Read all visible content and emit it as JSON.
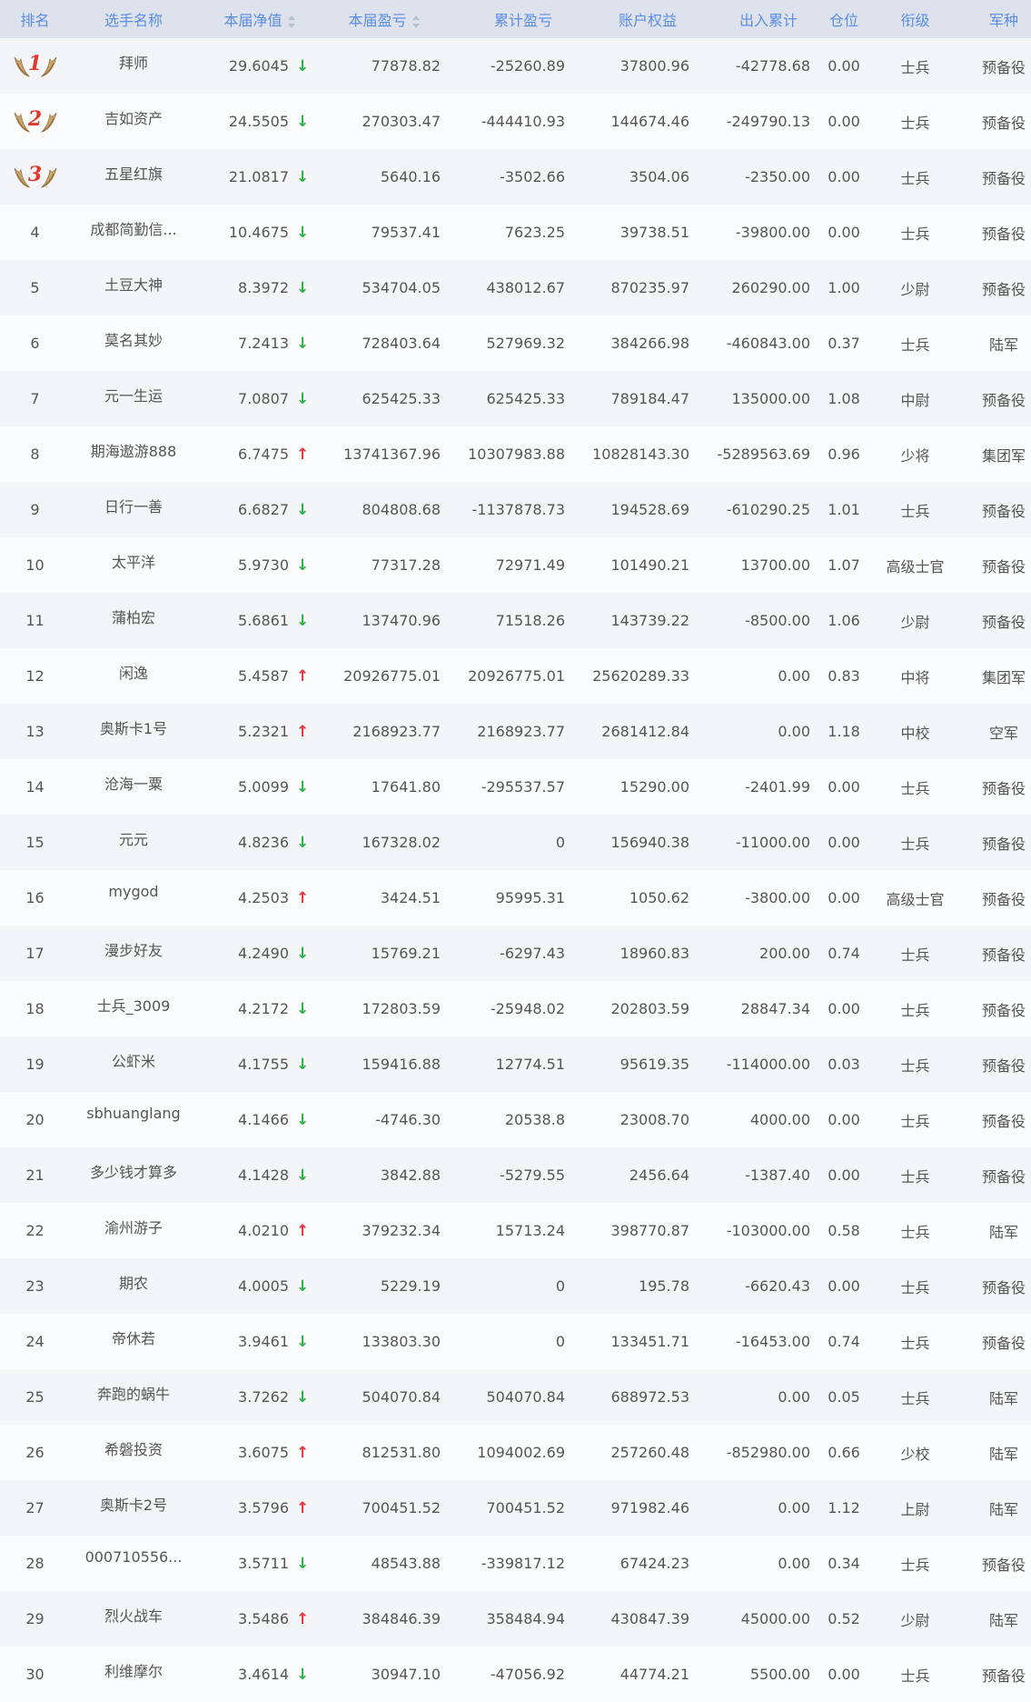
{
  "headers": {
    "rank": "排名",
    "name": "选手名称",
    "nav": "本届净值",
    "pnl": "本届盈亏",
    "cum_pnl": "累计盈亏",
    "equity": "账户权益",
    "io": "出入累计",
    "position": "仓位",
    "level": "衔级",
    "branch": "军种"
  },
  "colors": {
    "header_text": "#5b8de0",
    "up": "#e6363a",
    "down": "#2db245",
    "medal": "#e03a2e"
  },
  "rows": [
    {
      "rank": "1",
      "name": "拜师",
      "nav": "29.6045",
      "trend": "down",
      "pnl": "77878.82",
      "cum": "-25260.89",
      "equity": "37800.96",
      "io": "-42778.68",
      "pos": "0.00",
      "level": "士兵",
      "branch": "预备役"
    },
    {
      "rank": "2",
      "name": "吉如资产",
      "nav": "24.5505",
      "trend": "down",
      "pnl": "270303.47",
      "cum": "-444410.93",
      "equity": "144674.46",
      "io": "-249790.13",
      "pos": "0.00",
      "level": "士兵",
      "branch": "预备役"
    },
    {
      "rank": "3",
      "name": "五星红旗",
      "nav": "21.0817",
      "trend": "down",
      "pnl": "5640.16",
      "cum": "-3502.66",
      "equity": "3504.06",
      "io": "-2350.00",
      "pos": "0.00",
      "level": "士兵",
      "branch": "预备役"
    },
    {
      "rank": "4",
      "name": "成都简勤信...",
      "nav": "10.4675",
      "trend": "down",
      "pnl": "79537.41",
      "cum": "7623.25",
      "equity": "39738.51",
      "io": "-39800.00",
      "pos": "0.00",
      "level": "士兵",
      "branch": "预备役"
    },
    {
      "rank": "5",
      "name": "土豆大神",
      "nav": "8.3972",
      "trend": "down",
      "pnl": "534704.05",
      "cum": "438012.67",
      "equity": "870235.97",
      "io": "260290.00",
      "pos": "1.00",
      "level": "少尉",
      "branch": "预备役"
    },
    {
      "rank": "6",
      "name": "莫名其妙",
      "nav": "7.2413",
      "trend": "down",
      "pnl": "728403.64",
      "cum": "527969.32",
      "equity": "384266.98",
      "io": "-460843.00",
      "pos": "0.37",
      "level": "士兵",
      "branch": "陆军"
    },
    {
      "rank": "7",
      "name": "元一生运",
      "nav": "7.0807",
      "trend": "down",
      "pnl": "625425.33",
      "cum": "625425.33",
      "equity": "789184.47",
      "io": "135000.00",
      "pos": "1.08",
      "level": "中尉",
      "branch": "预备役"
    },
    {
      "rank": "8",
      "name": "期海遨游888",
      "nav": "6.7475",
      "trend": "up",
      "pnl": "13741367.96",
      "cum": "10307983.88",
      "equity": "10828143.30",
      "io": "-5289563.69",
      "pos": "0.96",
      "level": "少将",
      "branch": "集团军"
    },
    {
      "rank": "9",
      "name": "日行一善",
      "nav": "6.6827",
      "trend": "down",
      "pnl": "804808.68",
      "cum": "-1137878.73",
      "equity": "194528.69",
      "io": "-610290.25",
      "pos": "1.01",
      "level": "士兵",
      "branch": "预备役"
    },
    {
      "rank": "10",
      "name": "太平洋",
      "nav": "5.9730",
      "trend": "down",
      "pnl": "77317.28",
      "cum": "72971.49",
      "equity": "101490.21",
      "io": "13700.00",
      "pos": "1.07",
      "level": "高级士官",
      "branch": "预备役"
    },
    {
      "rank": "11",
      "name": "蒲柏宏",
      "nav": "5.6861",
      "trend": "down",
      "pnl": "137470.96",
      "cum": "71518.26",
      "equity": "143739.22",
      "io": "-8500.00",
      "pos": "1.06",
      "level": "少尉",
      "branch": "预备役"
    },
    {
      "rank": "12",
      "name": "闲逸",
      "nav": "5.4587",
      "trend": "up",
      "pnl": "20926775.01",
      "cum": "20926775.01",
      "equity": "25620289.33",
      "io": "0.00",
      "pos": "0.83",
      "level": "中将",
      "branch": "集团军"
    },
    {
      "rank": "13",
      "name": "奥斯卡1号",
      "nav": "5.2321",
      "trend": "up",
      "pnl": "2168923.77",
      "cum": "2168923.77",
      "equity": "2681412.84",
      "io": "0.00",
      "pos": "1.18",
      "level": "中校",
      "branch": "空军"
    },
    {
      "rank": "14",
      "name": "沧海一粟",
      "nav": "5.0099",
      "trend": "down",
      "pnl": "17641.80",
      "cum": "-295537.57",
      "equity": "15290.00",
      "io": "-2401.99",
      "pos": "0.00",
      "level": "士兵",
      "branch": "预备役"
    },
    {
      "rank": "15",
      "name": "元元",
      "nav": "4.8236",
      "trend": "down",
      "pnl": "167328.02",
      "cum": "0",
      "equity": "156940.38",
      "io": "-11000.00",
      "pos": "0.00",
      "level": "士兵",
      "branch": "预备役"
    },
    {
      "rank": "16",
      "name": "mygod",
      "nav": "4.2503",
      "trend": "up",
      "pnl": "3424.51",
      "cum": "95995.31",
      "equity": "1050.62",
      "io": "-3800.00",
      "pos": "0.00",
      "level": "高级士官",
      "branch": "预备役"
    },
    {
      "rank": "17",
      "name": "漫步好友",
      "nav": "4.2490",
      "trend": "down",
      "pnl": "15769.21",
      "cum": "-6297.43",
      "equity": "18960.83",
      "io": "200.00",
      "pos": "0.74",
      "level": "士兵",
      "branch": "预备役"
    },
    {
      "rank": "18",
      "name": "士兵_3009",
      "nav": "4.2172",
      "trend": "down",
      "pnl": "172803.59",
      "cum": "-25948.02",
      "equity": "202803.59",
      "io": "28847.34",
      "pos": "0.00",
      "level": "士兵",
      "branch": "预备役"
    },
    {
      "rank": "19",
      "name": "公虾米",
      "nav": "4.1755",
      "trend": "down",
      "pnl": "159416.88",
      "cum": "12774.51",
      "equity": "95619.35",
      "io": "-114000.00",
      "pos": "0.03",
      "level": "士兵",
      "branch": "预备役"
    },
    {
      "rank": "20",
      "name": "sbhuanglang",
      "nav": "4.1466",
      "trend": "down",
      "pnl": "-4746.30",
      "cum": "20538.8",
      "equity": "23008.70",
      "io": "4000.00",
      "pos": "0.00",
      "level": "士兵",
      "branch": "预备役"
    },
    {
      "rank": "21",
      "name": "多少钱才算多",
      "nav": "4.1428",
      "trend": "down",
      "pnl": "3842.88",
      "cum": "-5279.55",
      "equity": "2456.64",
      "io": "-1387.40",
      "pos": "0.00",
      "level": "士兵",
      "branch": "预备役"
    },
    {
      "rank": "22",
      "name": "渝州游子",
      "nav": "4.0210",
      "trend": "up",
      "pnl": "379232.34",
      "cum": "15713.24",
      "equity": "398770.87",
      "io": "-103000.00",
      "pos": "0.58",
      "level": "士兵",
      "branch": "陆军"
    },
    {
      "rank": "23",
      "name": "期农",
      "nav": "4.0005",
      "trend": "down",
      "pnl": "5229.19",
      "cum": "0",
      "equity": "195.78",
      "io": "-6620.43",
      "pos": "0.00",
      "level": "士兵",
      "branch": "预备役"
    },
    {
      "rank": "24",
      "name": "帝休若",
      "nav": "3.9461",
      "trend": "down",
      "pnl": "133803.30",
      "cum": "0",
      "equity": "133451.71",
      "io": "-16453.00",
      "pos": "0.74",
      "level": "士兵",
      "branch": "预备役"
    },
    {
      "rank": "25",
      "name": "奔跑的蜗牛",
      "nav": "3.7262",
      "trend": "down",
      "pnl": "504070.84",
      "cum": "504070.84",
      "equity": "688972.53",
      "io": "0.00",
      "pos": "0.05",
      "level": "士兵",
      "branch": "陆军"
    },
    {
      "rank": "26",
      "name": "希磐投资",
      "nav": "3.6075",
      "trend": "up",
      "pnl": "812531.80",
      "cum": "1094002.69",
      "equity": "257260.48",
      "io": "-852980.00",
      "pos": "0.66",
      "level": "少校",
      "branch": "陆军"
    },
    {
      "rank": "27",
      "name": "奥斯卡2号",
      "nav": "3.5796",
      "trend": "up",
      "pnl": "700451.52",
      "cum": "700451.52",
      "equity": "971982.46",
      "io": "0.00",
      "pos": "1.12",
      "level": "上尉",
      "branch": "陆军"
    },
    {
      "rank": "28",
      "name": "000710556...",
      "nav": "3.5711",
      "trend": "down",
      "pnl": "48543.88",
      "cum": "-339817.12",
      "equity": "67424.23",
      "io": "0.00",
      "pos": "0.34",
      "level": "士兵",
      "branch": "预备役"
    },
    {
      "rank": "29",
      "name": "烈火战车",
      "nav": "3.5486",
      "trend": "up",
      "pnl": "384846.39",
      "cum": "358484.94",
      "equity": "430847.39",
      "io": "45000.00",
      "pos": "0.52",
      "level": "少尉",
      "branch": "陆军"
    },
    {
      "rank": "30",
      "name": "利维摩尔",
      "nav": "3.4614",
      "trend": "down",
      "pnl": "30947.10",
      "cum": "-47056.92",
      "equity": "44774.21",
      "io": "5500.00",
      "pos": "0.00",
      "level": "士兵",
      "branch": "预备役"
    }
  ]
}
